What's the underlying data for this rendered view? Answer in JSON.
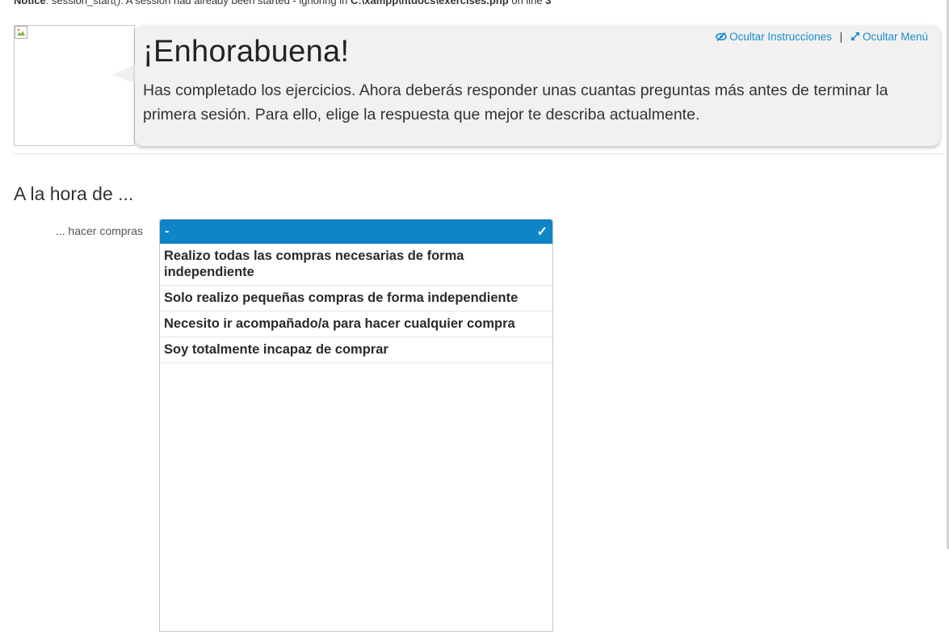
{
  "notice": {
    "label": "Notice",
    "message": ": session_start(): A session had already been started - ignoring in ",
    "path": "C:\\xampp\\htdocs\\exercises.php",
    "suffix": " on line ",
    "line": "3"
  },
  "bubble": {
    "title": "¡Enhorabuena!",
    "text": "Has completado los ejercicios. Ahora deberás responder unas cuantas preguntas más antes de terminar la primera sesión. Para ello, elige la respuesta que mejor te describa actualmente.",
    "hide_instructions": "Ocultar Instrucciones",
    "separator": "|",
    "hide_menu": "Ocultar Menú",
    "background_color": "#f1f1f1",
    "link_color": "#1a8ccc"
  },
  "section": {
    "title": "A la hora de ..."
  },
  "question": {
    "label": "... hacer compras",
    "selected": "-",
    "selected_icon": "checkmark-icon",
    "accent_color": "#0e85c7",
    "options": [
      "Realizo todas las compras necesarias de forma independiente",
      "Solo realizo pequeñas compras de forma independiente",
      "Necesito ir acompañado/a para hacer cualquier compra",
      "Soy totalmente incapaz de comprar"
    ]
  }
}
